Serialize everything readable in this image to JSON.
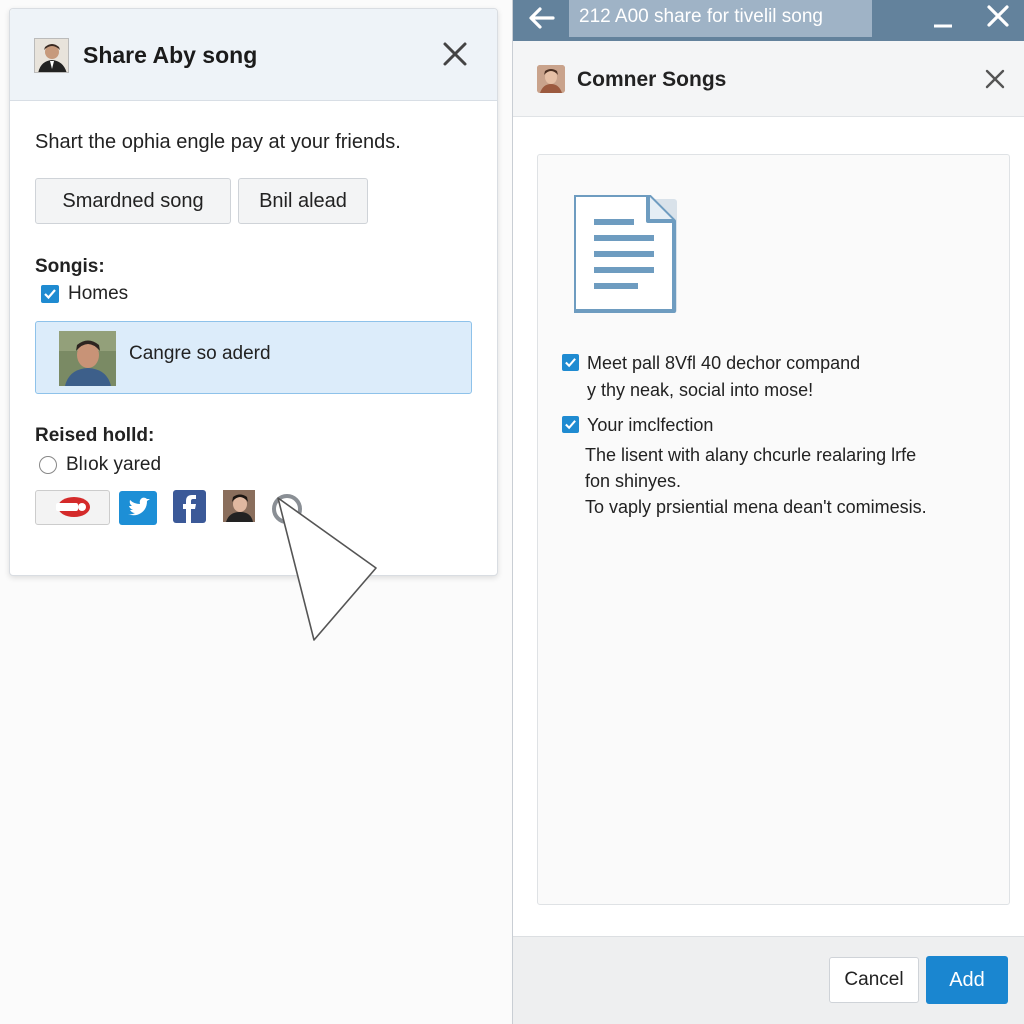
{
  "left_dialog": {
    "title": "Share Aby song",
    "description": "Shart the ophia engle pay at your friends.",
    "buttons": [
      "Smardned song",
      "Bnil alead"
    ],
    "songs_label": "Songis:",
    "songs_checkbox_label": "Homes",
    "selected_song": "Cangre so aderd",
    "reised_label": "Reised holld:",
    "radio_label": "Blıok yared"
  },
  "right_window": {
    "titlebar": "212 A00 share for tivelil song",
    "header_title": "Comner Songs",
    "items": [
      {
        "label": "Meet pall 8Vfl 40 dechor compand",
        "lines": [
          "y thy neak, social into mose!"
        ]
      },
      {
        "label": "Your imclfection",
        "lines": [
          "The lisent with alany chcurle realaring lrfe",
          "fon shinyes.",
          "To vaply prsiential mena dean't comimesis."
        ]
      }
    ],
    "cancel_label": "Cancel",
    "add_label": "Add"
  },
  "colors": {
    "accent": "#1a86d0",
    "titlebar": "#63829c",
    "selected_bg": "#dcecfa"
  }
}
